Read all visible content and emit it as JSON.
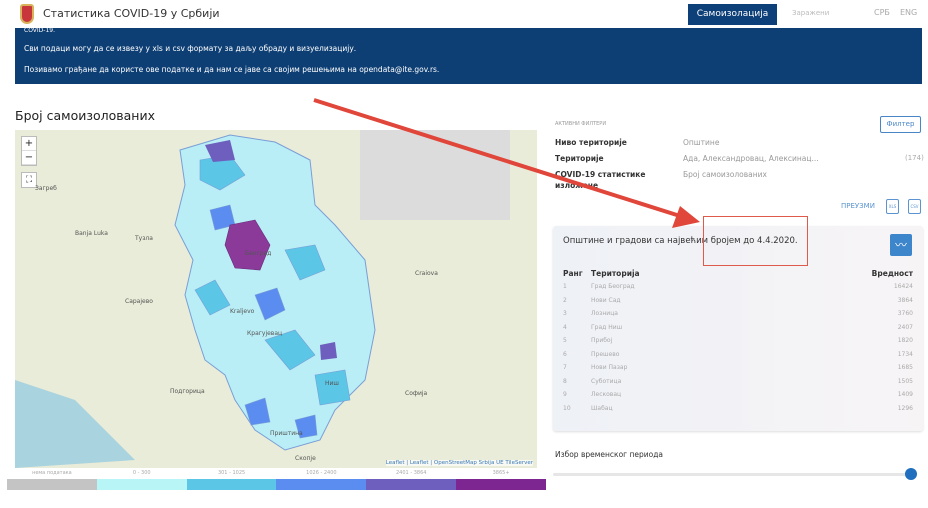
{
  "header": {
    "title": "Статистика COVID-19 у Србији",
    "nav_active": "Самоизолација",
    "nav_other": "Заражени",
    "lang_sr": "СРБ",
    "lang_en": "ENG"
  },
  "banner": {
    "line0": "COVID-19.",
    "line1": "Сви подаци могу да се извезу у xls и csv формату за даљу обраду и визуелизацију.",
    "line2": "Позивамо грађане да користе ове податке и да нам се јаве са својим решењима на opendata@ite.gov.rs."
  },
  "map": {
    "title": "Број самоизолованих",
    "zoom_in": "+",
    "zoom_out": "−",
    "fullscreen": "⛶",
    "attribution": "Leaflet | Leaflet | OpenStreetMap Srbija UE TileServer",
    "cities": [
      "Београд",
      "Крагујевац",
      "Ниш",
      "Приштина",
      "Скопје",
      "Софија",
      "Подгорица",
      "Сарајево",
      "Тузла",
      "Загреб",
      "Banja Luka",
      "Kraljevo",
      "Craiova"
    ],
    "legend": [
      {
        "label": "нема података",
        "color": "#c4c4c4"
      },
      {
        "label": "0 - 300",
        "color": "#b7f5f7"
      },
      {
        "label": "301 - 1025",
        "color": "#5bc6e6"
      },
      {
        "label": "1026 - 2400",
        "color": "#5b8cef"
      },
      {
        "label": "2401 - 3864",
        "color": "#6e5fbf"
      },
      {
        "label": "3865+",
        "color": "#7d2590"
      }
    ]
  },
  "filters": {
    "heading": "АКТИВНИ ФИЛТЕРИ",
    "button": "Филтер",
    "rows": [
      {
        "label": "Ниво територије",
        "value": "Општине"
      },
      {
        "label": "Територије",
        "value": "Ада, Александровац, Алексинац..."
      },
      {
        "label": "COVID-19 статистике",
        "label2": "изложене",
        "value": "Број самоизолованих"
      }
    ],
    "count": "(174)",
    "download": "ПРЕУЗМИ",
    "xls": "XLS",
    "csv": "CSV"
  },
  "ranking": {
    "title": "Општине и градови са највећим бројем до 4.4.2020.",
    "headers": [
      "Ранг",
      "Територија",
      "Вредност"
    ],
    "rows": [
      [
        "1",
        "Град Београд",
        "16424"
      ],
      [
        "2",
        "Нови Сад",
        "3864"
      ],
      [
        "3",
        "Лозница",
        "3760"
      ],
      [
        "4",
        "Град Ниш",
        "2407"
      ],
      [
        "5",
        "Прибој",
        "1820"
      ],
      [
        "6",
        "Прешево",
        "1734"
      ],
      [
        "7",
        "Нови Пазар",
        "1685"
      ],
      [
        "8",
        "Суботица",
        "1505"
      ],
      [
        "9",
        "Лесковац",
        "1409"
      ],
      [
        "10",
        "Шабац",
        "1296"
      ]
    ]
  },
  "period": {
    "label": "Избор временског периода",
    "value_percent": 100
  }
}
